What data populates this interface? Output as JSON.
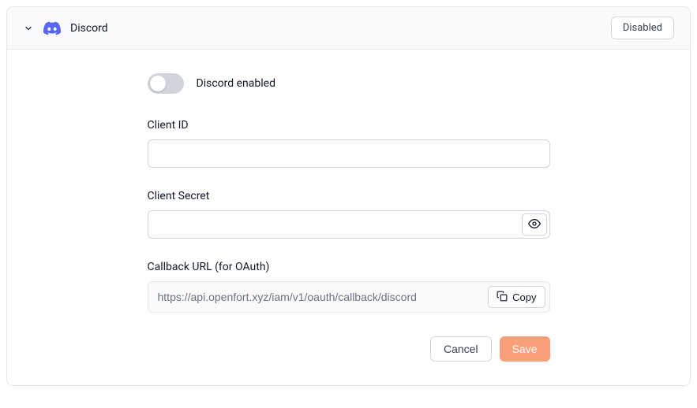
{
  "header": {
    "title": "Discord",
    "status": "Disabled"
  },
  "form": {
    "toggle_label": "Discord enabled",
    "client_id": {
      "label": "Client ID",
      "value": ""
    },
    "client_secret": {
      "label": "Client Secret",
      "value": ""
    },
    "callback": {
      "label": "Callback URL (for OAuth)",
      "value": "https://api.openfort.xyz/iam/v1/oauth/callback/discord",
      "copy_label": "Copy"
    },
    "buttons": {
      "cancel": "Cancel",
      "save": "Save"
    }
  }
}
